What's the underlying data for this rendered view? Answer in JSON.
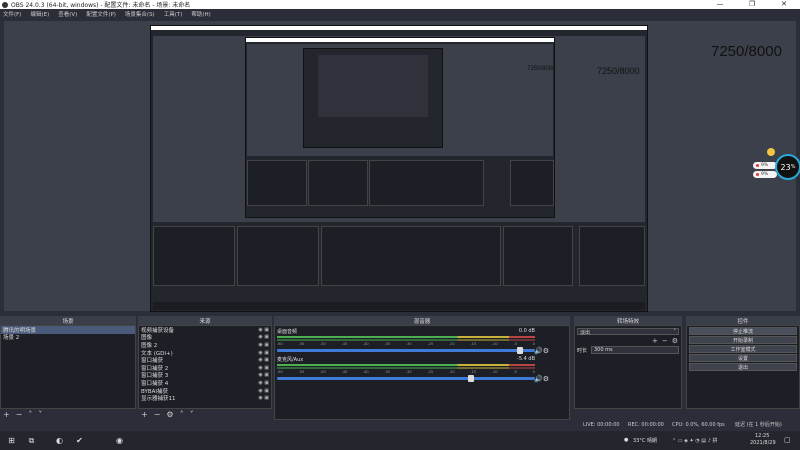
{
  "window": {
    "title": "OBS 24.0.3 (64-bit, windows) - 配置文件: 未命名 - 场景: 未命名",
    "controls": [
      "—",
      "❐",
      "✕"
    ]
  },
  "menu": [
    "文件(F)",
    "编辑(E)",
    "查看(V)",
    "配置文件(P)",
    "场景集合(S)",
    "工具(T)",
    "帮助(H)"
  ],
  "preview": {
    "counter_large": "7250/8000",
    "counter_medium": "7250/8000",
    "counter_small": "7250/8000",
    "widget_percent": "23",
    "widget_pct_sign": "%",
    "pill_top": "9%",
    "pill_bottom": "9%"
  },
  "docks": {
    "scenes": {
      "title": "场景",
      "items": [
        "腾讯的明场景",
        "场景 2"
      ]
    },
    "sources": {
      "title": "来源",
      "items": [
        "视频捕获设备",
        "图像",
        "图像 2",
        "文本 (GDI+)",
        "窗口捕获",
        "窗口捕获 2",
        "窗口捕获 3",
        "窗口捕获 4",
        "BYBAI捕获",
        "显示器捕获11"
      ]
    },
    "mixer": {
      "title": "混音器",
      "channels": [
        {
          "name": "桌面音频",
          "db": "0.0 dB",
          "level": 0.93
        },
        {
          "name": "麦克风/Aux",
          "db": "-5.4 dB",
          "level": 0.74
        }
      ],
      "scale": [
        "-60",
        "-55",
        "-50",
        "-45",
        "-40",
        "-35",
        "-30",
        "-25",
        "-20",
        "-15",
        "-10",
        "-5",
        "0"
      ]
    },
    "transitions": {
      "title": "转场特效",
      "type": "淡出",
      "duration_label": "时长",
      "duration_value": "300 ms"
    },
    "controls": {
      "title": "控件",
      "buttons": [
        "停止推流",
        "开始录制",
        "工作室模式",
        "设置",
        "退出"
      ]
    }
  },
  "statusbar": {
    "live": "LIVE: 00:00:00",
    "rec": "REC: 00:00:00",
    "cpu": "CPU: 0.0%, 60.00 fps",
    "delay": "延迟 (在 1 秒后开始)"
  },
  "taskbar": {
    "weather": "33°C 晴朗",
    "time": "12:25",
    "date": "2021/8/29"
  }
}
